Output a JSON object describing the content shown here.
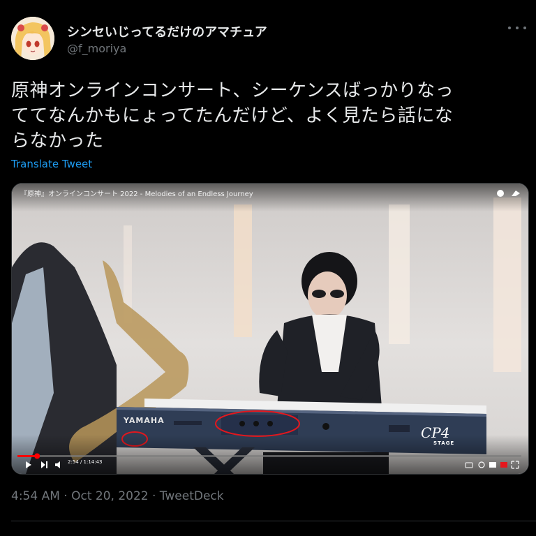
{
  "author": {
    "display_name": "シンセいじってるだけのアマチュア",
    "handle": "@f_moriya"
  },
  "tweet": {
    "text": "原神オンラインコンサート、シーケンスばっかりなっ\nててなんかもにょってたんだけど、よく見たら話にな\nらなかった",
    "translate_label": "Translate Tweet",
    "timestamp": "4:54 AM · Oct 20, 2022 · TweetDeck"
  },
  "video": {
    "title": "『原神』オンラインコンサート 2022 - Melodies of an Endless Journey",
    "time": "2:54 / 1:14:43",
    "progress_fraction": 0.039,
    "keyboard_brand": "YAMAHA",
    "keyboard_model": "CP4",
    "keyboard_model_sub": "STAGE"
  },
  "colors": {
    "link": "#1d9bf0",
    "muted": "#71767b",
    "annotation": "#e4171d",
    "progress": "#ff0000"
  }
}
